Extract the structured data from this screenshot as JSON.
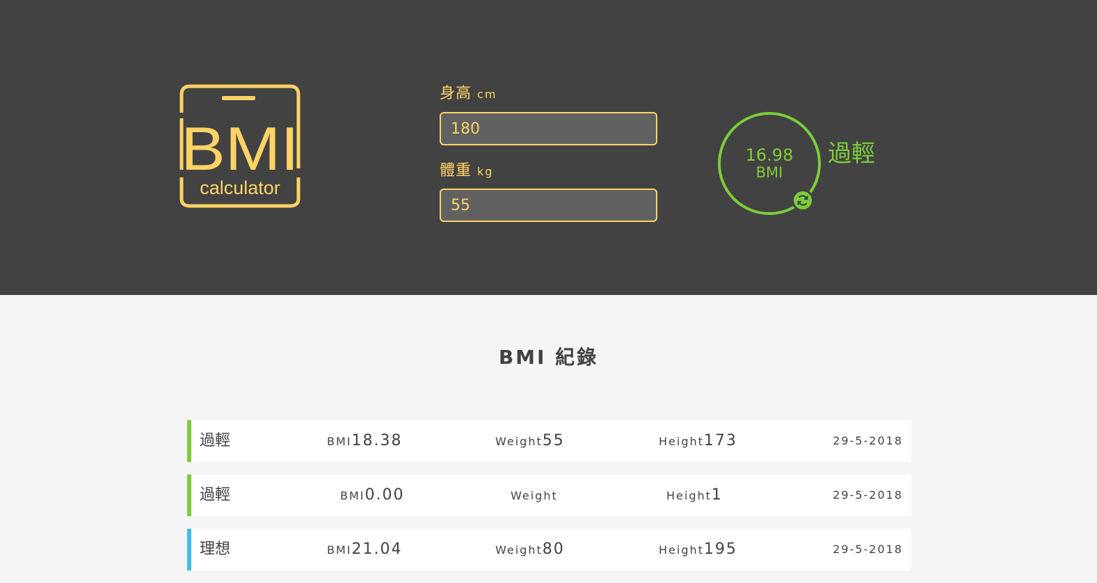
{
  "logo": {
    "text": "BMI",
    "subtitle": "calculator",
    "color": "#ffd366"
  },
  "form": {
    "height": {
      "label": "身高",
      "unit": "cm",
      "value": "180"
    },
    "weight": {
      "label": "體重",
      "unit": "kg",
      "value": "55"
    }
  },
  "result": {
    "value": "16.98",
    "unit": "BMI",
    "label": "過輕",
    "color": "#7ccd3a",
    "reset_icon": "refresh-icon"
  },
  "records_title": "BMI 紀錄",
  "colors": {
    "header": "#424242",
    "accent": "#ffd366",
    "underweight": "#7ccd3a",
    "ideal": "#41b9ee"
  },
  "records": [
    {
      "status": "過輕",
      "bmi_key": "BMI",
      "bmi": "18.38",
      "weight_key": "Weight",
      "weight": "55",
      "height_key": "Height",
      "height": "173",
      "date": "29-5-2018",
      "color": "#7ccd3a"
    },
    {
      "status": "過輕",
      "bmi_key": "BMI",
      "bmi": "0.00",
      "weight_key": "Weight",
      "weight": "",
      "height_key": "Height",
      "height": "1",
      "date": "29-5-2018",
      "color": "#7ccd3a"
    },
    {
      "status": "理想",
      "bmi_key": "BMI",
      "bmi": "21.04",
      "weight_key": "Weight",
      "weight": "80",
      "height_key": "Height",
      "height": "195",
      "date": "29-5-2018",
      "color": "#41b9ee"
    }
  ]
}
